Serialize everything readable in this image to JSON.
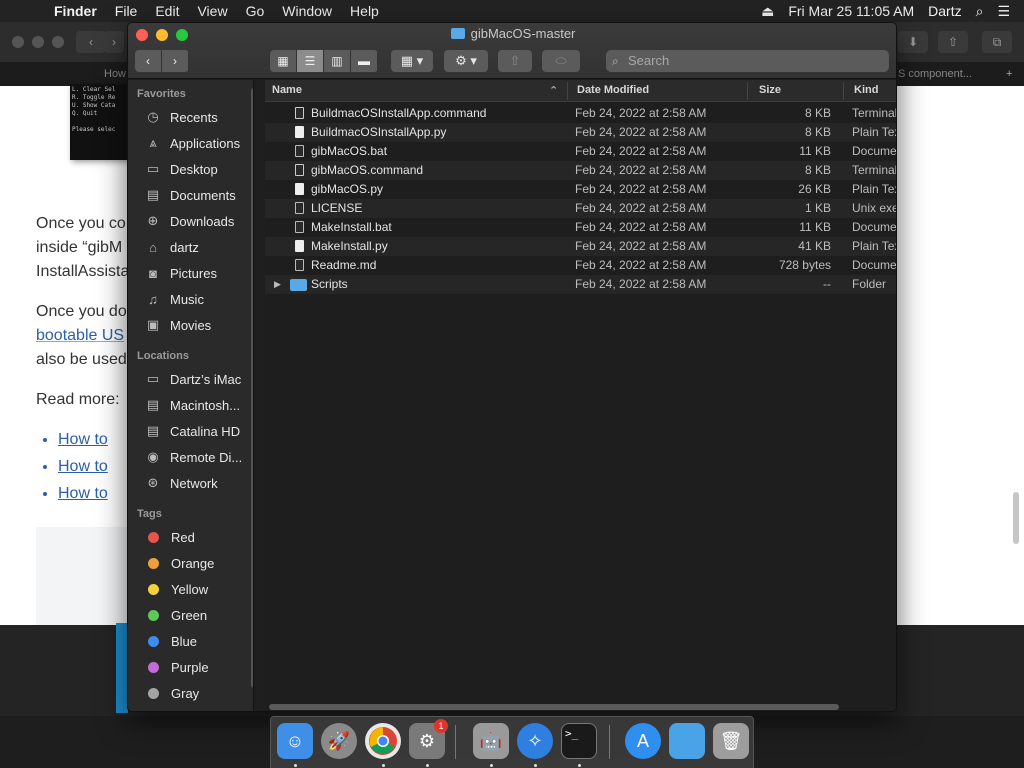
{
  "menubar": {
    "app": "Finder",
    "items": [
      "File",
      "Edit",
      "View",
      "Go",
      "Window",
      "Help"
    ],
    "clock": "Fri Mar 25  11:05 AM",
    "user": "Dartz"
  },
  "background": {
    "tab_left": "How",
    "tab_right": "S component...",
    "terminal_text": "L. Clear Sel\nR. Toggle Re\nU. Show Cata\nQ. Quit\n\nPlease selec",
    "para1_a": "Once you co",
    "para1_b": "inside “gibM",
    "para1_c": "InstallAssista",
    "para2_a": "Once you do",
    "para2_b": "bootable US",
    "para2_c": "also be used",
    "read_more": "Read more:",
    "links": [
      "How to",
      "How to",
      "How to"
    ]
  },
  "finder": {
    "title": "gibMacOS-master",
    "search_placeholder": "Search",
    "sidebar": {
      "favorites_header": "Favorites",
      "favorites": [
        {
          "label": "Recents",
          "icon": "clock-icon"
        },
        {
          "label": "Applications",
          "icon": "applications-icon"
        },
        {
          "label": "Desktop",
          "icon": "desktop-icon"
        },
        {
          "label": "Documents",
          "icon": "document-icon"
        },
        {
          "label": "Downloads",
          "icon": "download-icon"
        },
        {
          "label": "dartz",
          "icon": "home-icon"
        },
        {
          "label": "Pictures",
          "icon": "camera-icon"
        },
        {
          "label": "Music",
          "icon": "music-icon"
        },
        {
          "label": "Movies",
          "icon": "film-icon"
        }
      ],
      "locations_header": "Locations",
      "locations": [
        {
          "label": "Dartz’s iMac",
          "icon": "imac-icon"
        },
        {
          "label": "Macintosh...",
          "icon": "disk-icon"
        },
        {
          "label": "Catalina HD",
          "icon": "disk-icon"
        },
        {
          "label": "Remote Di...",
          "icon": "optical-disc-icon"
        },
        {
          "label": "Network",
          "icon": "network-icon"
        }
      ],
      "tags_header": "Tags",
      "tags": [
        {
          "label": "Red",
          "color": "#e6544e"
        },
        {
          "label": "Orange",
          "color": "#f0a03a"
        },
        {
          "label": "Yellow",
          "color": "#f4d23c"
        },
        {
          "label": "Green",
          "color": "#5ccb55"
        },
        {
          "label": "Blue",
          "color": "#3b8cf0"
        },
        {
          "label": "Purple",
          "color": "#c56ad9"
        },
        {
          "label": "Gray",
          "color": "#a4a4a4"
        }
      ]
    },
    "columns": {
      "name": "Name",
      "date": "Date Modified",
      "size": "Size",
      "kind": "Kind"
    },
    "files": [
      {
        "name": "BuildmacOSInstallApp.command",
        "date": "Feb 24, 2022 at 2:58 AM",
        "size": "8 KB",
        "kind": "Terminal",
        "icon": "exe"
      },
      {
        "name": "BuildmacOSInstallApp.py",
        "date": "Feb 24, 2022 at 2:58 AM",
        "size": "8 KB",
        "kind": "Plain Text",
        "icon": "doc"
      },
      {
        "name": "gibMacOS.bat",
        "date": "Feb 24, 2022 at 2:58 AM",
        "size": "11 KB",
        "kind": "Document",
        "icon": "dark"
      },
      {
        "name": "gibMacOS.command",
        "date": "Feb 24, 2022 at 2:58 AM",
        "size": "8 KB",
        "kind": "Terminal",
        "icon": "exe"
      },
      {
        "name": "gibMacOS.py",
        "date": "Feb 24, 2022 at 2:58 AM",
        "size": "26 KB",
        "kind": "Plain Text",
        "icon": "doc"
      },
      {
        "name": "LICENSE",
        "date": "Feb 24, 2022 at 2:58 AM",
        "size": "1 KB",
        "kind": "Unix executable",
        "icon": "dark"
      },
      {
        "name": "MakeInstall.bat",
        "date": "Feb 24, 2022 at 2:58 AM",
        "size": "11 KB",
        "kind": "Document",
        "icon": "dark"
      },
      {
        "name": "MakeInstall.py",
        "date": "Feb 24, 2022 at 2:58 AM",
        "size": "41 KB",
        "kind": "Plain Text",
        "icon": "doc"
      },
      {
        "name": "Readme.md",
        "date": "Feb 24, 2022 at 2:58 AM",
        "size": "728 bytes",
        "kind": "Document",
        "icon": "dark"
      },
      {
        "name": "Scripts",
        "date": "Feb 24, 2022 at 2:58 AM",
        "size": "--",
        "kind": "Folder",
        "icon": "folder"
      }
    ]
  },
  "dock": {
    "apps": [
      {
        "name": "finder-icon",
        "color": "#3f8ee8"
      },
      {
        "name": "launchpad-icon",
        "color": "#8a8a8a"
      },
      {
        "name": "chrome-icon",
        "color": "#e8e8e8"
      },
      {
        "name": "system-preferences-icon",
        "color": "#7a7a7a"
      },
      {
        "name": "automator-icon",
        "color": "#9a9a9a"
      },
      {
        "name": "safari-icon",
        "color": "#2f7fe0"
      },
      {
        "name": "terminal-icon",
        "color": "#1a1a1a"
      },
      {
        "name": "app-store-icon",
        "color": "#2e8ff0"
      },
      {
        "name": "folder-icon",
        "color": "#4aa3e6"
      },
      {
        "name": "trash-icon",
        "color": "#9d9d9d"
      }
    ],
    "badge": "1"
  }
}
